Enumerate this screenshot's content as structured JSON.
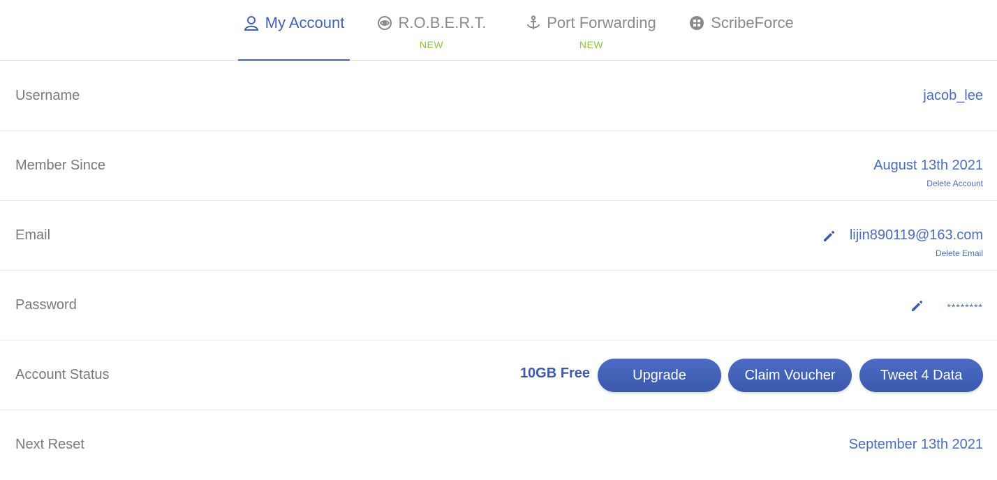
{
  "tabs": [
    {
      "label": "My Account",
      "icon": "user-icon",
      "badge": ""
    },
    {
      "label": "R.O.B.E.R.T.",
      "icon": "robot-eye-icon",
      "badge": "NEW"
    },
    {
      "label": "Port Forwarding",
      "icon": "anchor-icon",
      "badge": "NEW"
    },
    {
      "label": "ScribeForce",
      "icon": "globe-icon",
      "badge": ""
    }
  ],
  "active_tab": "My Account",
  "account": {
    "username": {
      "label": "Username",
      "value": "jacob_lee"
    },
    "member_since": {
      "label": "Member Since",
      "value": "August 13th 2021",
      "link": "Delete Account"
    },
    "email": {
      "label": "Email",
      "value": "lijin890119@163.com",
      "link": "Delete Email",
      "icon": "pencil-icon"
    },
    "password": {
      "label": "Password",
      "value": "********",
      "icon": "pencil-icon"
    },
    "status": {
      "label": "Account Status",
      "plan": "10GB Free",
      "buttons": {
        "upgrade": "Upgrade",
        "voucher": "Claim Voucher",
        "tweet": "Tweet 4 Data"
      }
    },
    "next_reset": {
      "label": "Next Reset",
      "value": "September 13th 2021"
    }
  },
  "colors": {
    "accent": "#4263b4",
    "badge_green": "#8cc63f",
    "button_blue": "#4263b4",
    "label_gray": "#7a7a7a"
  }
}
